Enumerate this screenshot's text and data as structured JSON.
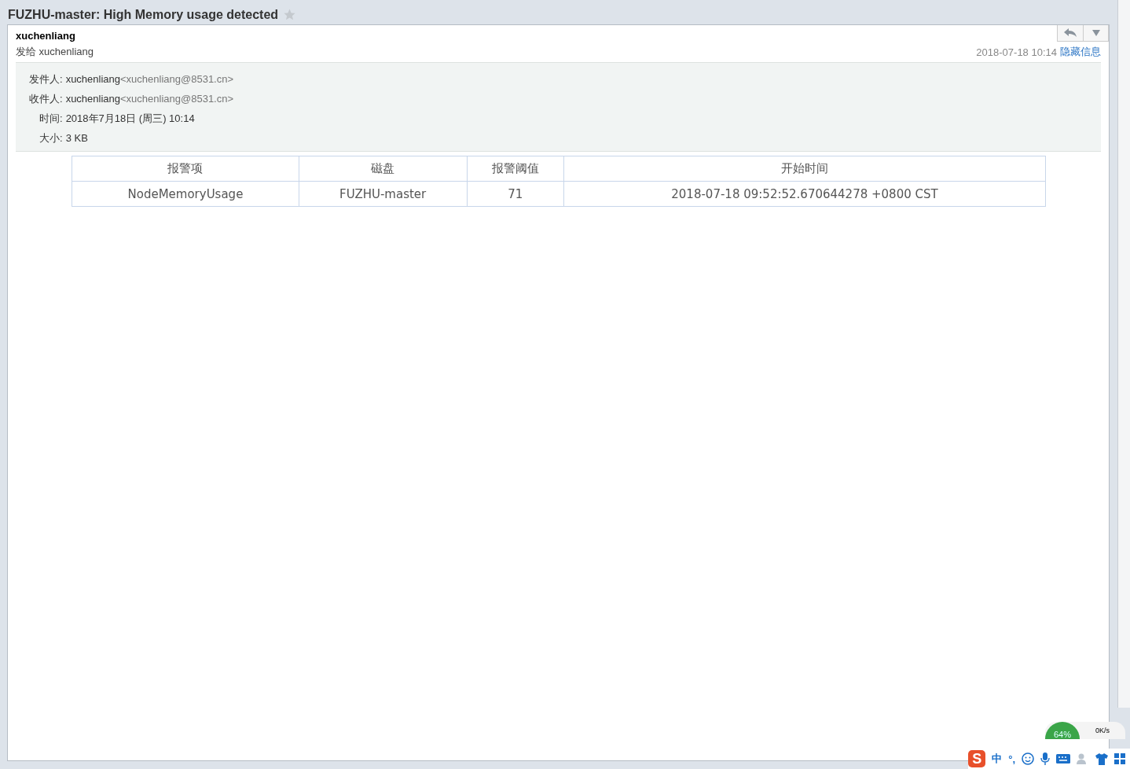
{
  "title": "FUZHU-master: High Memory usage detected",
  "starred": false,
  "sender": {
    "name": "xuchenliang",
    "to": "发给 xuchenliang",
    "date": "2018-07-18 10:14",
    "toggle_link": "隐藏信息"
  },
  "details": [
    {
      "label": "发件人:",
      "value": "xuchenliang",
      "address": "<xuchenliang@8531.cn>"
    },
    {
      "label": "收件人:",
      "value": "xuchenliang",
      "address": "<xuchenliang@8531.cn>"
    },
    {
      "label": "时间:",
      "value": "2018年7月18日 (周三) 10:14"
    },
    {
      "label": "大小:",
      "value": "3 KB"
    }
  ],
  "table": {
    "columns": [
      "报警项",
      "磁盘",
      "报警阈值",
      "开始时间"
    ],
    "rows": [
      [
        "NodeMemoryUsage",
        "FUZHU-master",
        "71",
        "2018-07-18 09:52:52.670644278 +0800 CST"
      ]
    ]
  },
  "ime_bar": {
    "logo": "S",
    "mode": "中",
    "punct": "°,",
    "memory": "64%",
    "speed": "0K/s"
  }
}
